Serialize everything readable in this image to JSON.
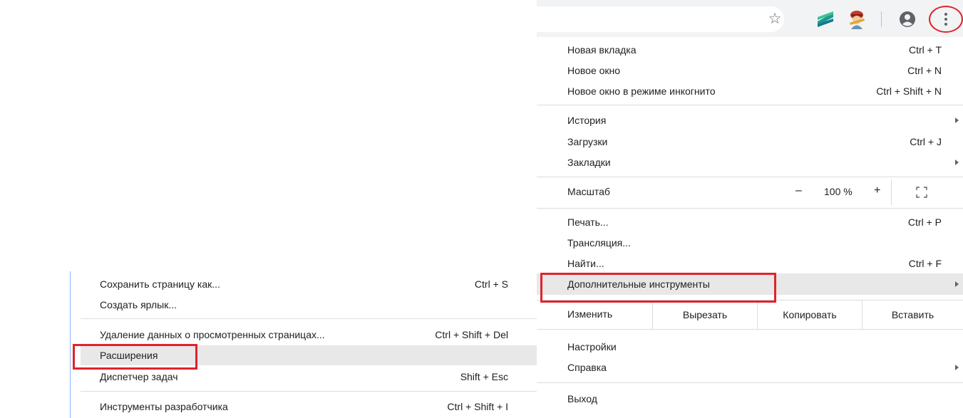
{
  "toolbar": {
    "icons": [
      "star-icon",
      "extension-icon",
      "extension-icon",
      "profile-icon",
      "more-vert-icon"
    ],
    "accent": "#e0232b"
  },
  "main_menu": {
    "new_tab": {
      "label": "Новая вкладка",
      "shortcut": "Ctrl + T"
    },
    "new_window": {
      "label": "Новое окно",
      "shortcut": "Ctrl + N"
    },
    "incognito": {
      "label": "Новое окно в режиме инкогнито",
      "shortcut": "Ctrl + Shift + N"
    },
    "history": {
      "label": "История"
    },
    "downloads": {
      "label": "Загрузки",
      "shortcut": "Ctrl + J"
    },
    "bookmarks": {
      "label": "Закладки"
    },
    "zoom": {
      "label": "Масштаб",
      "minus": "–",
      "value": "100 %",
      "plus": "+"
    },
    "print": {
      "label": "Печать...",
      "shortcut": "Ctrl + P"
    },
    "cast": {
      "label": "Трансляция..."
    },
    "find": {
      "label": "Найти...",
      "shortcut": "Ctrl + F"
    },
    "more_tools": {
      "label": "Дополнительные инструменты"
    },
    "edit": {
      "label": "Изменить",
      "cut": "Вырезать",
      "copy": "Копировать",
      "paste": "Вставить"
    },
    "settings": {
      "label": "Настройки"
    },
    "help": {
      "label": "Справка"
    },
    "exit": {
      "label": "Выход"
    }
  },
  "sub_menu": {
    "save_page": {
      "label": "Сохранить страницу как...",
      "shortcut": "Ctrl + S"
    },
    "create_shortcut": {
      "label": "Создать ярлык..."
    },
    "clear_data": {
      "label": "Удаление данных о просмотренных страницах...",
      "shortcut": "Ctrl + Shift + Del"
    },
    "extensions": {
      "label": "Расширения"
    },
    "task_manager": {
      "label": "Диспетчер задач",
      "shortcut": "Shift + Esc"
    },
    "dev_tools": {
      "label": "Инструменты разработчика",
      "shortcut": "Ctrl + Shift + I"
    }
  }
}
